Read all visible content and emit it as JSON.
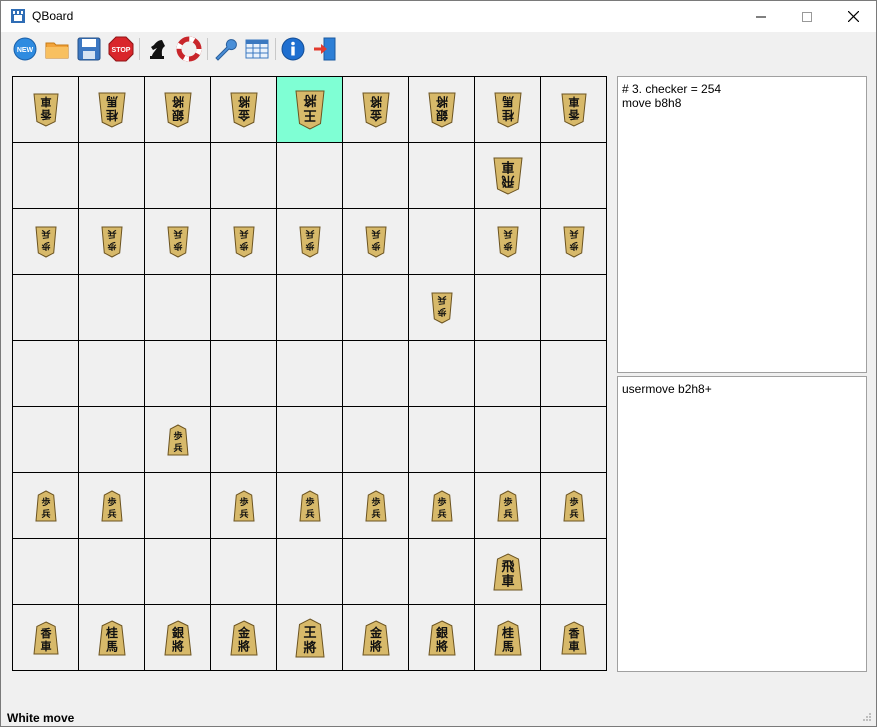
{
  "window": {
    "title": "QBoard"
  },
  "toolbar": {
    "tools": [
      {
        "name": "new",
        "icon": "new-icon"
      },
      {
        "name": "open",
        "icon": "folder-icon"
      },
      {
        "name": "save",
        "icon": "floppy-icon"
      },
      {
        "name": "stop",
        "icon": "stop-icon"
      },
      {
        "name": "engine",
        "icon": "knight-icon"
      },
      {
        "name": "flip",
        "icon": "lifebuoy-icon"
      },
      {
        "name": "settings",
        "icon": "wrench-icon"
      },
      {
        "name": "table",
        "icon": "table-icon"
      },
      {
        "name": "info",
        "icon": "info-icon"
      },
      {
        "name": "exit",
        "icon": "exit-icon"
      }
    ],
    "new_label": "NEW",
    "stop_label": "STOP"
  },
  "board": {
    "files": 9,
    "ranks": 9,
    "highlight": {
      "row": 0,
      "col": 4
    },
    "highlight_color": "#7fffd4",
    "piece_color": "#d7b96a",
    "pieces": [
      {
        "row": 0,
        "col": 0,
        "type": "lance",
        "owner": "gote"
      },
      {
        "row": 0,
        "col": 1,
        "type": "knight",
        "owner": "gote"
      },
      {
        "row": 0,
        "col": 2,
        "type": "silver",
        "owner": "gote"
      },
      {
        "row": 0,
        "col": 3,
        "type": "gold",
        "owner": "gote"
      },
      {
        "row": 0,
        "col": 4,
        "type": "king",
        "owner": "gote"
      },
      {
        "row": 0,
        "col": 5,
        "type": "gold",
        "owner": "gote"
      },
      {
        "row": 0,
        "col": 6,
        "type": "silver",
        "owner": "gote"
      },
      {
        "row": 0,
        "col": 7,
        "type": "knight",
        "owner": "gote"
      },
      {
        "row": 0,
        "col": 8,
        "type": "lance",
        "owner": "gote"
      },
      {
        "row": 1,
        "col": 7,
        "type": "rook",
        "owner": "gote"
      },
      {
        "row": 2,
        "col": 0,
        "type": "pawn",
        "owner": "gote"
      },
      {
        "row": 2,
        "col": 1,
        "type": "pawn",
        "owner": "gote"
      },
      {
        "row": 2,
        "col": 2,
        "type": "pawn",
        "owner": "gote"
      },
      {
        "row": 2,
        "col": 3,
        "type": "pawn",
        "owner": "gote"
      },
      {
        "row": 2,
        "col": 4,
        "type": "pawn",
        "owner": "gote"
      },
      {
        "row": 2,
        "col": 5,
        "type": "pawn",
        "owner": "gote"
      },
      {
        "row": 2,
        "col": 7,
        "type": "pawn",
        "owner": "gote"
      },
      {
        "row": 2,
        "col": 8,
        "type": "pawn",
        "owner": "gote"
      },
      {
        "row": 3,
        "col": 6,
        "type": "pawn",
        "owner": "gote"
      },
      {
        "row": 5,
        "col": 2,
        "type": "pawn",
        "owner": "sente"
      },
      {
        "row": 6,
        "col": 0,
        "type": "pawn",
        "owner": "sente"
      },
      {
        "row": 6,
        "col": 1,
        "type": "pawn",
        "owner": "sente"
      },
      {
        "row": 6,
        "col": 3,
        "type": "pawn",
        "owner": "sente"
      },
      {
        "row": 6,
        "col": 4,
        "type": "pawn",
        "owner": "sente"
      },
      {
        "row": 6,
        "col": 5,
        "type": "pawn",
        "owner": "sente"
      },
      {
        "row": 6,
        "col": 6,
        "type": "pawn",
        "owner": "sente"
      },
      {
        "row": 6,
        "col": 7,
        "type": "pawn",
        "owner": "sente"
      },
      {
        "row": 6,
        "col": 8,
        "type": "pawn",
        "owner": "sente"
      },
      {
        "row": 7,
        "col": 7,
        "type": "rook",
        "owner": "sente"
      },
      {
        "row": 8,
        "col": 0,
        "type": "lance",
        "owner": "sente"
      },
      {
        "row": 8,
        "col": 1,
        "type": "knight",
        "owner": "sente"
      },
      {
        "row": 8,
        "col": 2,
        "type": "silver",
        "owner": "sente"
      },
      {
        "row": 8,
        "col": 3,
        "type": "gold",
        "owner": "sente"
      },
      {
        "row": 8,
        "col": 4,
        "type": "king",
        "owner": "sente"
      },
      {
        "row": 8,
        "col": 5,
        "type": "gold",
        "owner": "sente"
      },
      {
        "row": 8,
        "col": 6,
        "type": "silver",
        "owner": "sente"
      },
      {
        "row": 8,
        "col": 7,
        "type": "knight",
        "owner": "sente"
      },
      {
        "row": 8,
        "col": 8,
        "type": "lance",
        "owner": "sente"
      }
    ],
    "glyphs": {
      "king": [
        "王",
        "將"
      ],
      "rook": [
        "飛",
        "車"
      ],
      "gold": [
        "金",
        "將"
      ],
      "silver": [
        "銀",
        "將"
      ],
      "knight": [
        "桂",
        "馬"
      ],
      "lance": [
        "香",
        "車"
      ],
      "pawn": [
        "歩",
        "兵"
      ]
    }
  },
  "engine_output": {
    "lines": [
      "#  3. checker = 254",
      "move b8h8"
    ]
  },
  "command_log": {
    "lines": [
      "usermove b2h8+"
    ]
  },
  "status_bar": {
    "text": "White move"
  }
}
